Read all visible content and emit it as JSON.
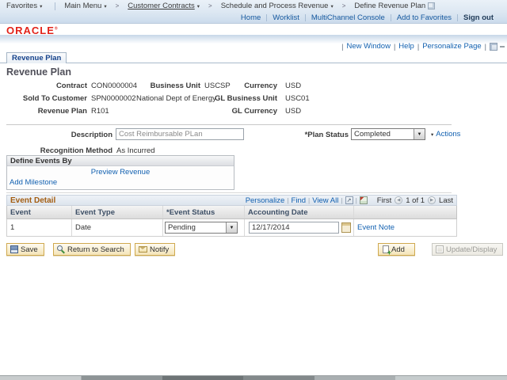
{
  "colors": {
    "link": "#1160b0",
    "oracle_red": "#e2231a",
    "grid_title": "#a35d11",
    "button_face": "#f4e4b8"
  },
  "breadcrumb": {
    "favorites": "Favorites",
    "main_menu": "Main Menu",
    "items": [
      "Customer Contracts",
      "Schedule and Process Revenue",
      "Define Revenue Plan"
    ]
  },
  "header": {
    "links": [
      "Home",
      "Worklist",
      "MultiChannel Console",
      "Add to Favorites"
    ],
    "sign_out": "Sign out",
    "logo": "ORACLE",
    "logo_mark": "®"
  },
  "page_links": {
    "new_window": "New Window",
    "help": "Help",
    "personalize_page": "Personalize Page"
  },
  "tab_label": "Revenue Plan",
  "page_title": "Revenue Plan",
  "info": {
    "contract_label": "Contract",
    "contract_value": "CON0000004",
    "business_unit_label": "Business Unit",
    "business_unit_value": "USCSP",
    "currency_label": "Currency",
    "currency_value": "USD",
    "sold_to_label": "Sold To Customer",
    "sold_to_value": "SPN0000002",
    "sold_to_name": "National Dept of Energy",
    "gl_business_unit_label": "GL Business Unit",
    "gl_business_unit_value": "USC01",
    "revenue_plan_label": "Revenue Plan",
    "revenue_plan_value": "R101",
    "gl_currency_label": "GL Currency",
    "gl_currency_value": "USD"
  },
  "form": {
    "description_label": "Description",
    "description_value": "Cost Reimbursable PLan",
    "plan_status_label": "*Plan Status",
    "plan_status_value": "Completed",
    "actions_label": "Actions",
    "recognition_label": "Recognition Method",
    "recognition_value": "As Incurred"
  },
  "define_events": {
    "title": "Define Events By",
    "preview_revenue": "Preview Revenue",
    "add_milestone": "Add Milestone"
  },
  "event_detail": {
    "title": "Event Detail",
    "toolbar": {
      "personalize": "Personalize",
      "find": "Find",
      "view_all": "View All"
    },
    "pager": {
      "first": "First",
      "count": "1 of 1",
      "last": "Last"
    },
    "columns": [
      "Event",
      "Event Type",
      "*Event Status",
      "Accounting Date"
    ],
    "row": {
      "event": "1",
      "event_type": "Date",
      "event_status": "Pending",
      "accounting_date": "12/17/2014",
      "note_link": "Event Note"
    }
  },
  "buttons": {
    "save": "Save",
    "return_to_search": "Return to Search",
    "notify": "Notify",
    "add": "Add",
    "update_display": "Update/Display"
  },
  "icons": {
    "dropdown": "▼",
    "menu_chevron": "▾",
    "crumb_sep": ">",
    "pager_prev": "◀",
    "pager_next": "▶",
    "popup": "↗",
    "pipe": "|"
  }
}
